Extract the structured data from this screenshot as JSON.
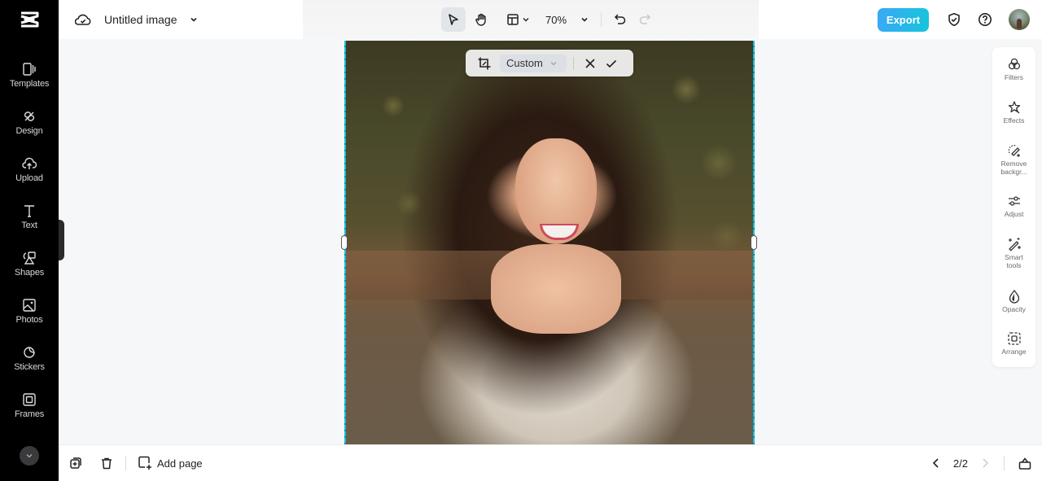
{
  "app": {
    "document_title": "Untitled image"
  },
  "sidebar": {
    "items": [
      {
        "label": "Templates",
        "icon": "templates-icon"
      },
      {
        "label": "Design",
        "icon": "design-icon"
      },
      {
        "label": "Upload",
        "icon": "upload-icon"
      },
      {
        "label": "Text",
        "icon": "text-icon"
      },
      {
        "label": "Shapes",
        "icon": "shapes-icon"
      },
      {
        "label": "Photos",
        "icon": "photos-icon"
      },
      {
        "label": "Stickers",
        "icon": "stickers-icon"
      },
      {
        "label": "Frames",
        "icon": "frames-icon"
      }
    ]
  },
  "toolbar": {
    "zoom_level": "70%",
    "export_label": "Export"
  },
  "crop_bar": {
    "ratio_value": "Custom"
  },
  "right_panel": {
    "items": [
      {
        "label": "Filters",
        "icon": "filters-icon"
      },
      {
        "label": "Effects",
        "icon": "effects-icon"
      },
      {
        "label": "Remove backgr...",
        "icon": "remove-background-icon"
      },
      {
        "label": "Adjust",
        "icon": "adjust-icon"
      },
      {
        "label": "Smart tools",
        "icon": "smart-tools-icon"
      },
      {
        "label": "Opacity",
        "icon": "opacity-icon"
      },
      {
        "label": "Arrange",
        "icon": "arrange-icon"
      }
    ]
  },
  "bottombar": {
    "add_page_label": "Add page",
    "page_indicator": "2/2"
  },
  "colors": {
    "accent": "#17c4dc",
    "export_gradient_start": "#3aa9f5",
    "sidebar_bg": "#000000",
    "selection": "#14c2e0"
  }
}
